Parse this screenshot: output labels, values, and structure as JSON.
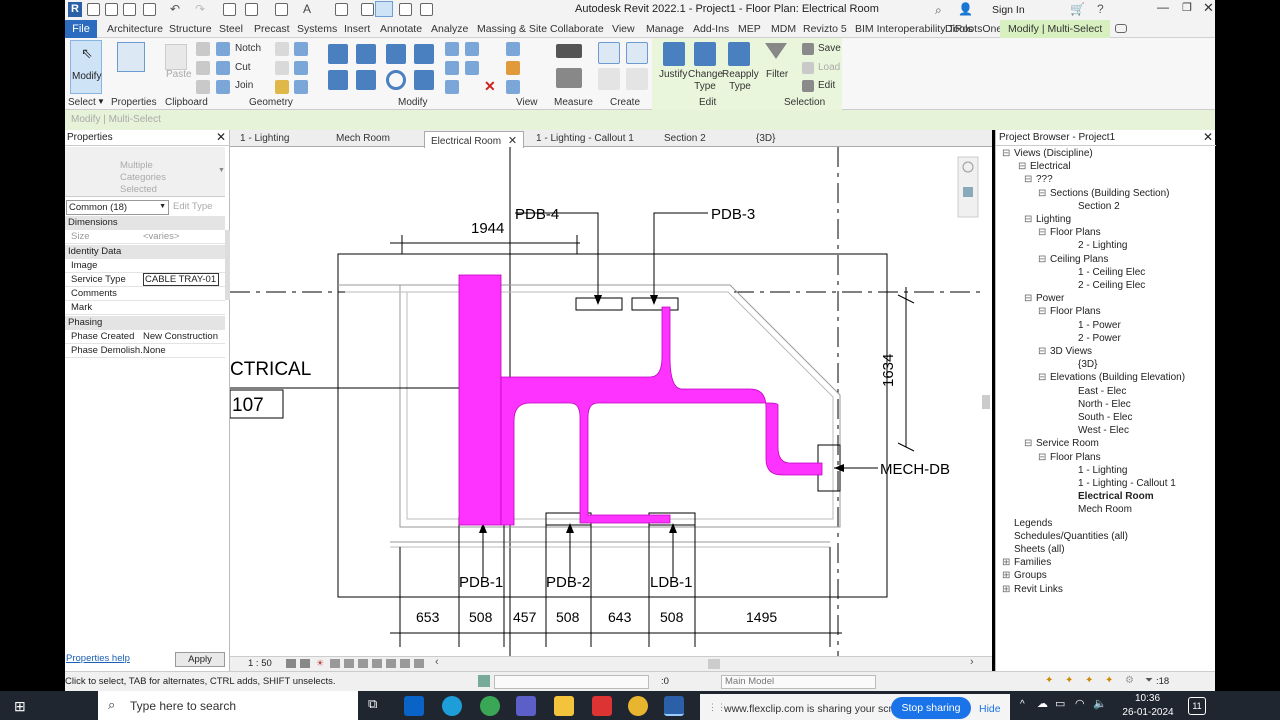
{
  "window": {
    "title": "Autodesk Revit 2022.1 - Project1 - Floor Plan: Electrical Room",
    "sign_in": "Sign In",
    "app_icon": "R"
  },
  "menu": {
    "file": "File",
    "items": [
      "Architecture",
      "Structure",
      "Steel",
      "Precast",
      "Systems",
      "Insert",
      "Annotate",
      "Analyze",
      "Massing & Site",
      "Collaborate",
      "View",
      "Manage",
      "Add-Ins",
      "MEP",
      "MDM",
      "Revizto 5",
      "BIM Interoperability Tools",
      "DiRootsOne"
    ],
    "context_tab": "Modify | Multi-Select"
  },
  "ribbon": {
    "modify": "Modify",
    "select": "Select",
    "properties": "Properties",
    "paste": "Paste",
    "notch": "Notch",
    "cut": "Cut",
    "join": "Join",
    "justify": "Justify",
    "change_type": "Change Type",
    "reapply_type": "Reapply Type",
    "filter": "Filter",
    "save": "Save",
    "load": "Load",
    "edit": "Edit",
    "panels": {
      "select": "Select",
      "properties": "Properties",
      "clipboard": "Clipboard",
      "geometry": "Geometry",
      "modify": "Modify",
      "view": "View",
      "measure": "Measure",
      "create": "Create",
      "edit": "Edit",
      "selection": "Selection"
    }
  },
  "mode_bar": "Modify | Multi-Select",
  "properties": {
    "title": "Properties",
    "type_selector": "Multiple Categories Selected",
    "filter": "Common (18)",
    "edit_type": "Edit Type",
    "groups": {
      "dimensions": "Dimensions",
      "identity": "Identity Data",
      "phasing": "Phasing"
    },
    "rows": {
      "size": {
        "k": "Size",
        "v": "<varies>"
      },
      "image": {
        "k": "Image",
        "v": ""
      },
      "service_type": {
        "k": "Service Type",
        "v": "CABLE TRAY-01"
      },
      "comments": {
        "k": "Comments",
        "v": ""
      },
      "mark": {
        "k": "Mark",
        "v": ""
      },
      "phase_created": {
        "k": "Phase Created",
        "v": "New Construction"
      },
      "phase_demolished": {
        "k": "Phase Demolish...",
        "v": "None"
      }
    },
    "help": "Properties help",
    "apply": "Apply"
  },
  "view_tabs": [
    "1 - Lighting",
    "Mech Room",
    "Electrical Room",
    "1 - Lighting - Callout 1",
    "Section 2",
    "{3D}"
  ],
  "active_tab": "Electrical Room",
  "drawing": {
    "room_name": "CTRICAL",
    "room_number": "107",
    "labels": {
      "pdb4": "PDB-4",
      "pdb3": "PDB-3",
      "pdb1": "PDB-1",
      "pdb2": "PDB-2",
      "ldb1": "LDB-1",
      "mechdb": "MECH-DB"
    },
    "dims_top": "1944",
    "dims_right": "1634",
    "dims_bottom": [
      "653",
      "508",
      "457",
      "508",
      "643",
      "508",
      "1495"
    ],
    "tray_color": "#ff33ff"
  },
  "view_controls": {
    "scale": "1 : 50"
  },
  "browser": {
    "title": "Project Browser - Project1",
    "nodes": [
      {
        "t": "Views (Discipline)",
        "lvl": 0,
        "sign": "minus"
      },
      {
        "t": "Electrical",
        "lvl": 1,
        "sign": "minus"
      },
      {
        "t": "???",
        "lvl": 2,
        "sign": "minus"
      },
      {
        "t": "Sections (Building Section)",
        "lvl": 3,
        "sign": "minus"
      },
      {
        "t": "Section 2",
        "lvl": 4,
        "sign": ""
      },
      {
        "t": "Lighting",
        "lvl": 2,
        "sign": "minus"
      },
      {
        "t": "Floor Plans",
        "lvl": 3,
        "sign": "minus"
      },
      {
        "t": "2 - Lighting",
        "lvl": 4,
        "sign": ""
      },
      {
        "t": "Ceiling Plans",
        "lvl": 3,
        "sign": "minus"
      },
      {
        "t": "1 - Ceiling Elec",
        "lvl": 4,
        "sign": ""
      },
      {
        "t": "2 - Ceiling Elec",
        "lvl": 4,
        "sign": ""
      },
      {
        "t": "Power",
        "lvl": 2,
        "sign": "minus"
      },
      {
        "t": "Floor Plans",
        "lvl": 3,
        "sign": "minus"
      },
      {
        "t": "1 - Power",
        "lvl": 4,
        "sign": ""
      },
      {
        "t": "2 - Power",
        "lvl": 4,
        "sign": ""
      },
      {
        "t": "3D Views",
        "lvl": 3,
        "sign": "minus"
      },
      {
        "t": "{3D}",
        "lvl": 4,
        "sign": ""
      },
      {
        "t": "Elevations (Building Elevation)",
        "lvl": 3,
        "sign": "minus"
      },
      {
        "t": "East - Elec",
        "lvl": 4,
        "sign": ""
      },
      {
        "t": "North - Elec",
        "lvl": 4,
        "sign": ""
      },
      {
        "t": "South - Elec",
        "lvl": 4,
        "sign": ""
      },
      {
        "t": "West - Elec",
        "lvl": 4,
        "sign": ""
      },
      {
        "t": "Service Room",
        "lvl": 2,
        "sign": "minus"
      },
      {
        "t": "Floor Plans",
        "lvl": 3,
        "sign": "minus"
      },
      {
        "t": "1 - Lighting",
        "lvl": 4,
        "sign": ""
      },
      {
        "t": "1 - Lighting - Callout 1",
        "lvl": 4,
        "sign": ""
      },
      {
        "t": "Electrical Room",
        "lvl": 4,
        "sign": "",
        "bold": true
      },
      {
        "t": "Mech Room",
        "lvl": 4,
        "sign": ""
      },
      {
        "t": "Legends",
        "lvl": 0,
        "sign": ""
      },
      {
        "t": "Schedules/Quantities (all)",
        "lvl": 0,
        "sign": ""
      },
      {
        "t": "Sheets (all)",
        "lvl": 0,
        "sign": ""
      },
      {
        "t": "Families",
        "lvl": 0,
        "sign": "plus"
      },
      {
        "t": "Groups",
        "lvl": 0,
        "sign": "plus"
      },
      {
        "t": "Revit Links",
        "lvl": 0,
        "sign": "plus"
      }
    ]
  },
  "status": {
    "hint": "Click to select, TAB for alternates, CTRL adds, SHIFT unselects.",
    "zero": ":0",
    "model": "Main Model",
    "filter_count": ":18"
  },
  "taskbar": {
    "search": "Type here to search",
    "share_text": "www.flexclip.com is sharing your screen.",
    "stop_sharing": "Stop sharing",
    "hide": "Hide",
    "time": "10:36",
    "date": "26-01-2024",
    "badge": "11"
  }
}
